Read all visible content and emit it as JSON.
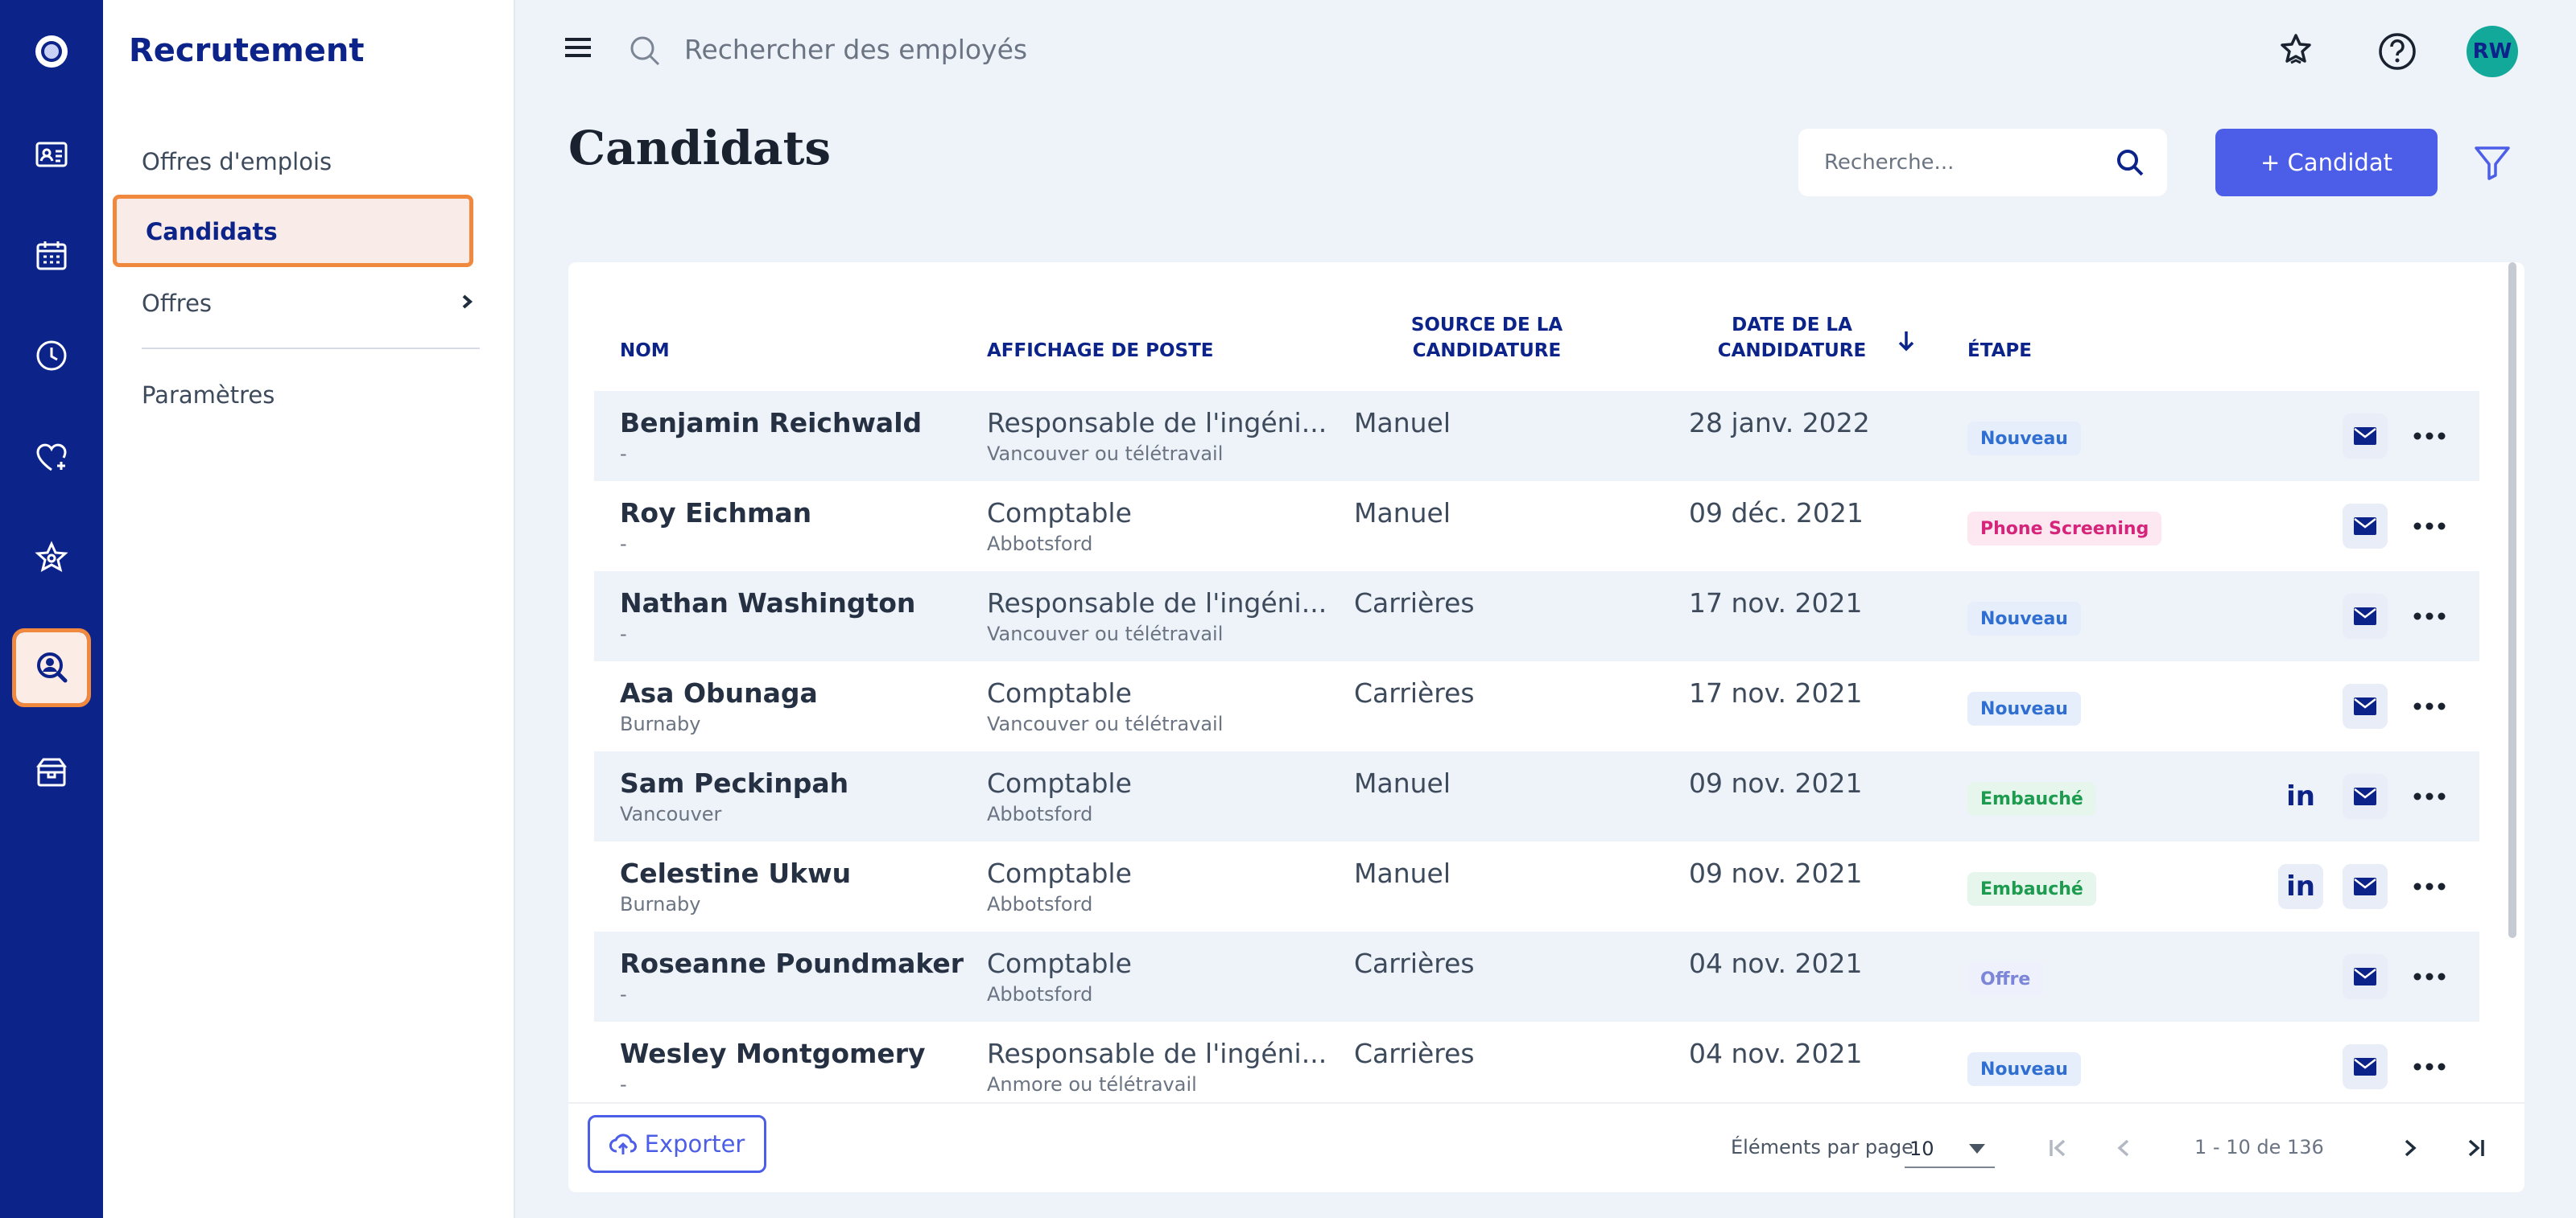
{
  "topbar": {
    "search_placeholder": "Rechercher des employés",
    "avatar_initials": "RW"
  },
  "rail": {
    "icons": [
      "logo-icon",
      "id-card-icon",
      "calendar-icon",
      "clock-icon",
      "heart-plus-icon",
      "star-badge-icon",
      "recruitment-search-icon",
      "gift-box-icon"
    ],
    "active": "recruitment-search-icon"
  },
  "sidebar": {
    "title": "Recrutement",
    "items": [
      {
        "label": "Offres d'emplois"
      },
      {
        "label": "Candidats"
      },
      {
        "label": "Offres"
      },
      {
        "label": "Paramètres"
      }
    ]
  },
  "header": {
    "title": "Candidats",
    "search_placeholder": "Recherche...",
    "add_label": "+ Candidat"
  },
  "table": {
    "columns": {
      "name": "NOM",
      "posting": "AFFICHAGE DE POSTE",
      "source_line1": "SOURCE DE LA",
      "source_line2": "CANDIDATURE",
      "date_line1": "DATE DE LA",
      "date_line2": "CANDIDATURE",
      "stage": "ÉTAPE"
    },
    "rows": [
      {
        "name": "Benjamin Reichwald",
        "location": "-",
        "posting": "Responsable de l'ingéni...",
        "posting_location": "Vancouver ou télétravail",
        "source": "Manuel",
        "date": "28 janv. 2022",
        "stage": "Nouveau"
      },
      {
        "name": "Roy Eichman",
        "location": "-",
        "posting": "Comptable",
        "posting_location": "Abbotsford",
        "source": "Manuel",
        "date": "09 déc. 2021",
        "stage": "Phone Screening"
      },
      {
        "name": "Nathan Washington",
        "location": "-",
        "posting": "Responsable de l'ingéni...",
        "posting_location": "Vancouver ou télétravail",
        "source": "Carrières",
        "date": "17 nov. 2021",
        "stage": "Nouveau"
      },
      {
        "name": "Asa Obunaga",
        "location": "Burnaby",
        "posting": "Comptable",
        "posting_location": "Vancouver ou télétravail",
        "source": "Carrières",
        "date": "17 nov. 2021",
        "stage": "Nouveau"
      },
      {
        "name": "Sam Peckinpah",
        "location": "Vancouver",
        "posting": "Comptable",
        "posting_location": "Abbotsford",
        "source": "Manuel",
        "date": "09 nov. 2021",
        "stage": "Embauché"
      },
      {
        "name": "Celestine Ukwu",
        "location": "Burnaby",
        "posting": "Comptable",
        "posting_location": "Abbotsford",
        "source": "Manuel",
        "date": "09 nov. 2021",
        "stage": "Embauché"
      },
      {
        "name": "Roseanne Poundmaker",
        "location": "-",
        "posting": "Comptable",
        "posting_location": "Abbotsford",
        "source": "Carrières",
        "date": "04 nov. 2021",
        "stage": "Offre"
      },
      {
        "name": "Wesley Montgomery",
        "location": "-",
        "posting": "Responsable de l'ingéni...",
        "posting_location": "Anmore ou télétravail",
        "source": "Carrières",
        "date": "04 nov. 2021",
        "stage": "Nouveau"
      }
    ],
    "linkedin_label": "in"
  },
  "footer": {
    "export_label": "Exporter",
    "per_page_label": "Éléments par page",
    "per_page_value": "10",
    "range": "1 - 10 de 136"
  },
  "colors": {
    "rail_bg": "#0c2389",
    "primary": "#4c5ee8",
    "highlight": "#f0883e",
    "avatar": "#12a99a"
  }
}
